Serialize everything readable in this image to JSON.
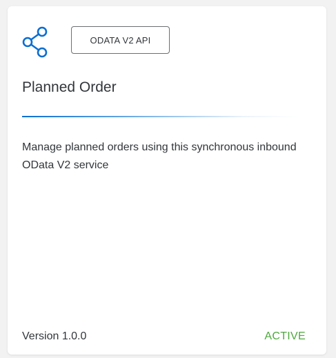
{
  "card": {
    "icon": "share-icon",
    "badge_label": "ODATA V2 API",
    "title": "Planned Order",
    "description": "Manage planned orders using this synchronous inbound OData V2 service",
    "version_label": "Version 1.0.0",
    "status_label": "ACTIVE"
  },
  "colors": {
    "accent": "#0a6ed1",
    "status_active": "#4fa83d",
    "text": "#32363a"
  }
}
